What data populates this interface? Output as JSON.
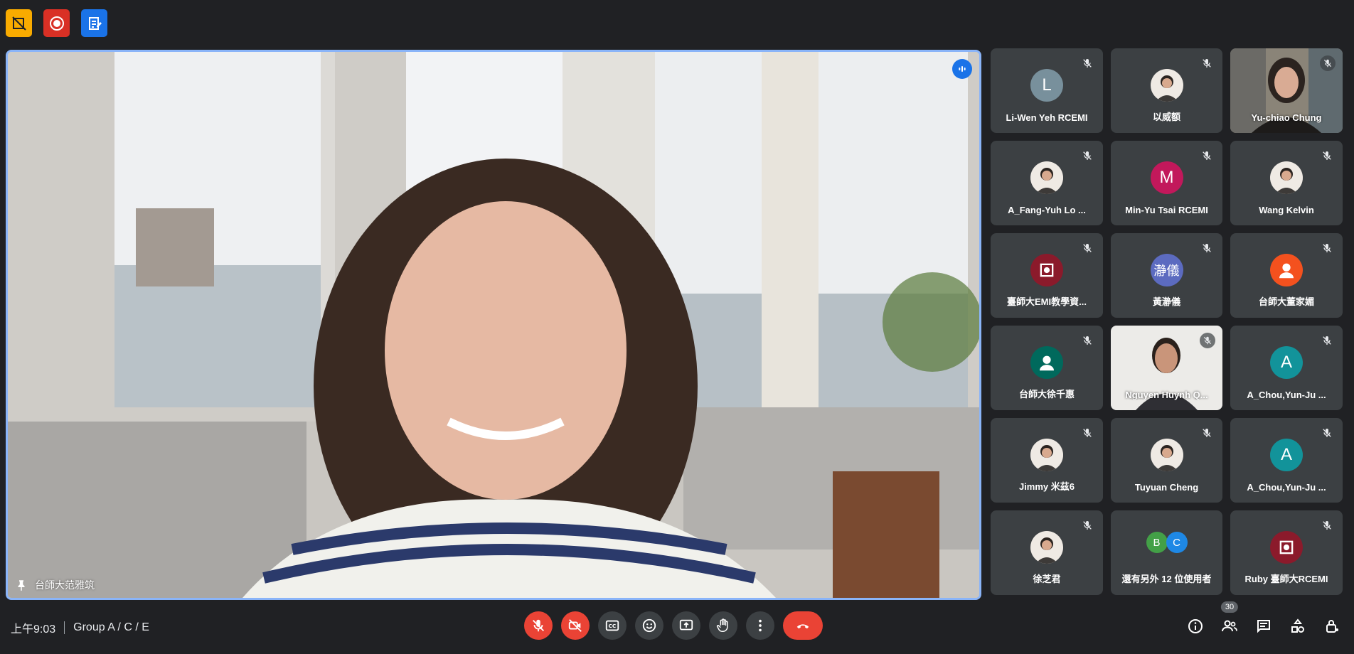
{
  "top_badges": [
    {
      "name": "no-recording-icon",
      "color": "#f9ab00"
    },
    {
      "name": "recording-icon",
      "color": "#d93025"
    },
    {
      "name": "notes-icon",
      "color": "#1a73e8"
    }
  ],
  "stage": {
    "speaker_name": "台師大范雅筑"
  },
  "participants": [
    {
      "name": "Li-Wen Yeh RCEMI",
      "avatar": "L",
      "avatar_color": "#78909c",
      "type": "letter"
    },
    {
      "name": "以威额",
      "avatar": "",
      "type": "photo"
    },
    {
      "name": "Yu-chiao Chung",
      "avatar": "",
      "type": "video"
    },
    {
      "name": "A_Fang-Yuh Lo ...",
      "avatar": "",
      "type": "photo"
    },
    {
      "name": "Min-Yu Tsai RCEMI",
      "avatar": "M",
      "avatar_color": "#c2185b",
      "type": "letter"
    },
    {
      "name": "Wang Kelvin",
      "avatar": "",
      "type": "photo"
    },
    {
      "name": "臺師大EMI教學資...",
      "avatar": "",
      "type": "logo"
    },
    {
      "name": "黃瀞儀",
      "avatar": "瀞儀",
      "avatar_color": "#5c6bc0",
      "type": "letter"
    },
    {
      "name": "台師大董家媚",
      "avatar": "",
      "avatar_color": "#f4511e",
      "type": "person"
    },
    {
      "name": "台師大徐千惠",
      "avatar": "",
      "avatar_color": "#00695c",
      "type": "person"
    },
    {
      "name": "Nguyen Huynh Q...",
      "avatar": "",
      "type": "video"
    },
    {
      "name": "A_Chou,Yun-Ju ...",
      "avatar": "A",
      "avatar_color": "#12939a",
      "type": "letter"
    },
    {
      "name": "Jimmy 米茲6",
      "avatar": "",
      "type": "photo"
    },
    {
      "name": "Tuyuan Cheng",
      "avatar": "",
      "type": "photo"
    },
    {
      "name": "A_Chou,Yun-Ju ...",
      "avatar": "A",
      "avatar_color": "#12939a",
      "type": "letter"
    },
    {
      "name": "徐芝君",
      "avatar": "",
      "type": "photo"
    },
    {
      "name": "還有另外 12 位使用者",
      "avatar": "",
      "type": "more"
    },
    {
      "name": "Ruby 臺師大RCEMI",
      "avatar": "",
      "type": "logo"
    }
  ],
  "more_avatars": [
    {
      "letter": "B",
      "color": "#43a047"
    },
    {
      "letter": "C",
      "color": "#1e88e5"
    }
  ],
  "meeting": {
    "time": "上午9:03",
    "title": "Group A / C / E"
  },
  "participants_count": "30",
  "controls": [
    "mic-off",
    "camera-off",
    "captions",
    "emoji",
    "present",
    "raise-hand",
    "more",
    "hang-up"
  ]
}
